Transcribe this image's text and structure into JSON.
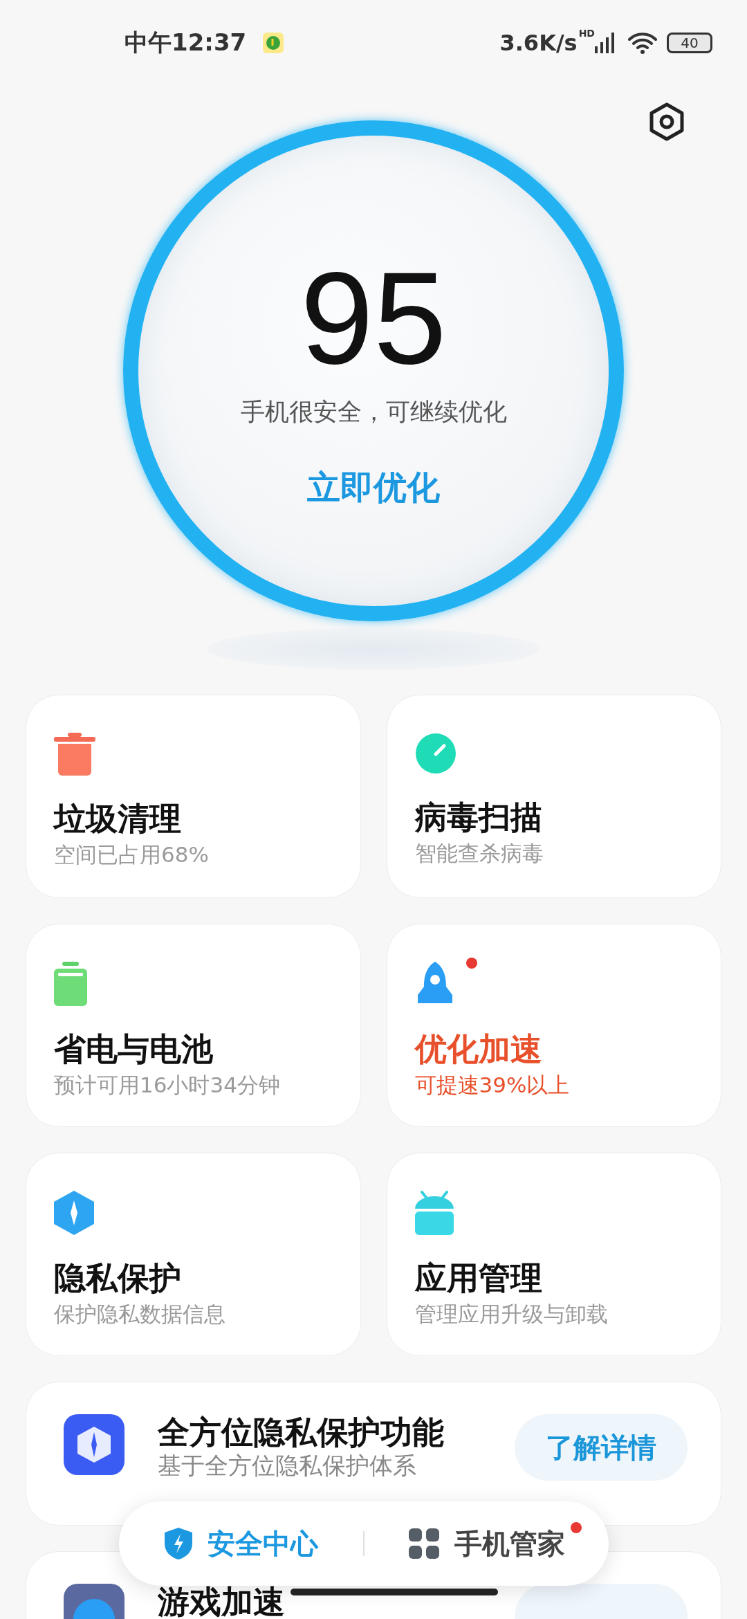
{
  "status_bar": {
    "time": "中午12:37",
    "speed": "3.6K/s",
    "network_label": "HD",
    "battery": "40"
  },
  "score": {
    "value": "95",
    "message": "手机很安全，可继续优化",
    "action": "立即优化"
  },
  "tiles": [
    {
      "kind": "trash",
      "title": "垃圾清理",
      "subtitle": "空间已占用68%",
      "highlighted": false,
      "badge": false
    },
    {
      "kind": "scan",
      "title": "病毒扫描",
      "subtitle": "智能查杀病毒",
      "highlighted": false,
      "badge": false
    },
    {
      "kind": "battery",
      "title": "省电与电池",
      "subtitle": "预计可用16小时34分钟",
      "highlighted": false,
      "badge": false
    },
    {
      "kind": "rocket",
      "title": "优化加速",
      "subtitle": "可提速39%以上",
      "highlighted": true,
      "badge": true
    },
    {
      "kind": "privacy",
      "title": "隐私保护",
      "subtitle": "保护隐私数据信息",
      "highlighted": false,
      "badge": false
    },
    {
      "kind": "apps",
      "title": "应用管理",
      "subtitle": "管理应用升级与卸载",
      "highlighted": false,
      "badge": false
    }
  ],
  "promos": [
    {
      "kind": "privacy",
      "title": "全方位隐私保护功能",
      "subtitle": "基于全方位隐私保护体系",
      "button": "了解详情"
    },
    {
      "kind": "game",
      "title": "游戏加速"
    }
  ],
  "bottom_nav": [
    {
      "kind": "shield",
      "label": "安全中心",
      "selected": true,
      "badge": false
    },
    {
      "kind": "grid",
      "label": "手机管家",
      "selected": false,
      "badge": true
    }
  ]
}
